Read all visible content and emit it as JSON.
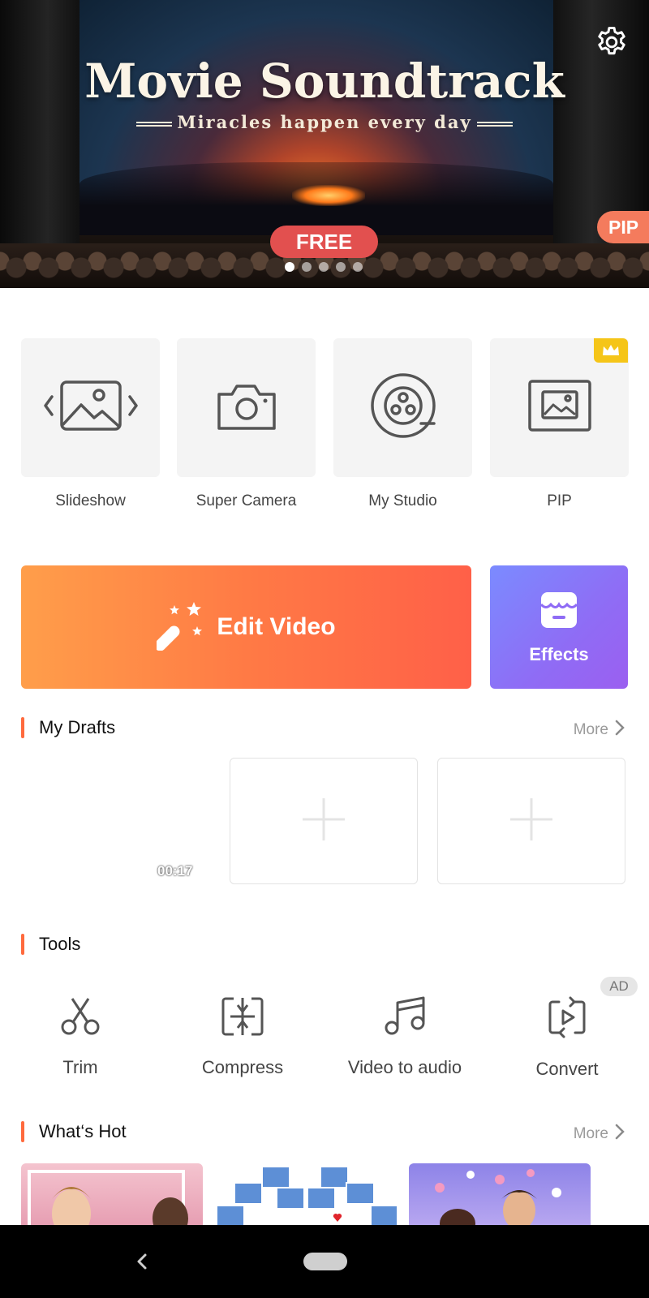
{
  "banner": {
    "title": "Movie Soundtrack",
    "subtitle": "Miracles happen every day",
    "free_label": "FREE",
    "pip_label": "PIP",
    "dots": [
      true,
      false,
      false,
      false,
      false
    ]
  },
  "features": [
    {
      "label": "Slideshow",
      "icon": "slideshow-icon"
    },
    {
      "label": "Super Camera",
      "icon": "camera-icon"
    },
    {
      "label": "My Studio",
      "icon": "film-reel-icon"
    },
    {
      "label": "PIP",
      "icon": "pip-icon",
      "premium": true
    }
  ],
  "actions": {
    "edit_video": "Edit Video",
    "effects": "Effects"
  },
  "drafts": {
    "title": "My Drafts",
    "more": "More",
    "first_duration": "00:17"
  },
  "tools": {
    "title": "Tools",
    "ad_label": "AD",
    "items": [
      {
        "label": "Trim",
        "icon": "scissors-icon"
      },
      {
        "label": "Compress",
        "icon": "compress-icon"
      },
      {
        "label": "Video to audio",
        "icon": "music-note-icon"
      },
      {
        "label": "Convert",
        "icon": "convert-icon"
      }
    ]
  },
  "hot": {
    "title": "What‘s Hot",
    "more": "More"
  },
  "colors": {
    "accent": "#ff6a3d",
    "edit_gradient_start": "#ff9e4a",
    "edit_gradient_end": "#ff6048",
    "effects_gradient_start": "#7b8bff",
    "effects_gradient_end": "#9b5ff0",
    "premium": "#f5c518"
  }
}
